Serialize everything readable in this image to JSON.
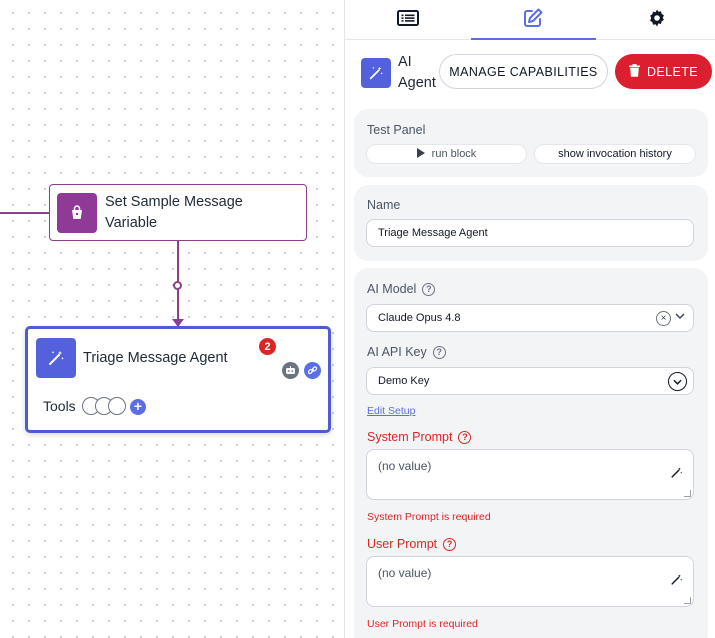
{
  "canvas": {
    "node_set_variable": {
      "label": "Set Sample Message Variable"
    },
    "node_agent": {
      "label": "Triage Message Agent",
      "badge_count": "2",
      "tools_label": "Tools",
      "add_tool": "+"
    }
  },
  "panel": {
    "tabs": [
      {
        "name": "list",
        "icon": "list-icon"
      },
      {
        "name": "edit",
        "icon": "edit-icon",
        "active": true
      },
      {
        "name": "settings",
        "icon": "gear-icon"
      }
    ],
    "header": {
      "title": "AI Agent",
      "manage_label": "MANAGE CAPABILITIES",
      "delete_label": "DELETE"
    },
    "test_panel": {
      "label": "Test Panel",
      "run_label": "run block",
      "history_label": "show invocation history"
    },
    "name": {
      "label": "Name",
      "value": "Triage Message Agent"
    },
    "ai_model": {
      "label": "AI Model",
      "value": "Claude Opus 4.8",
      "clear": "×"
    },
    "api_key": {
      "label": "AI API Key",
      "value": "Demo Key",
      "edit_setup": "Edit Setup"
    },
    "system_prompt": {
      "label": "System Prompt",
      "placeholder": "(no value)",
      "error": "System Prompt is required"
    },
    "user_prompt": {
      "label": "User Prompt",
      "placeholder": "(no value)",
      "error": "User Prompt is required"
    }
  },
  "colors": {
    "accent": "#5b6ee8",
    "agent_icon": "#5461dc",
    "variable_icon": "#8e3a96",
    "edge": "#8b3f8c",
    "danger": "#dc1f2e"
  }
}
